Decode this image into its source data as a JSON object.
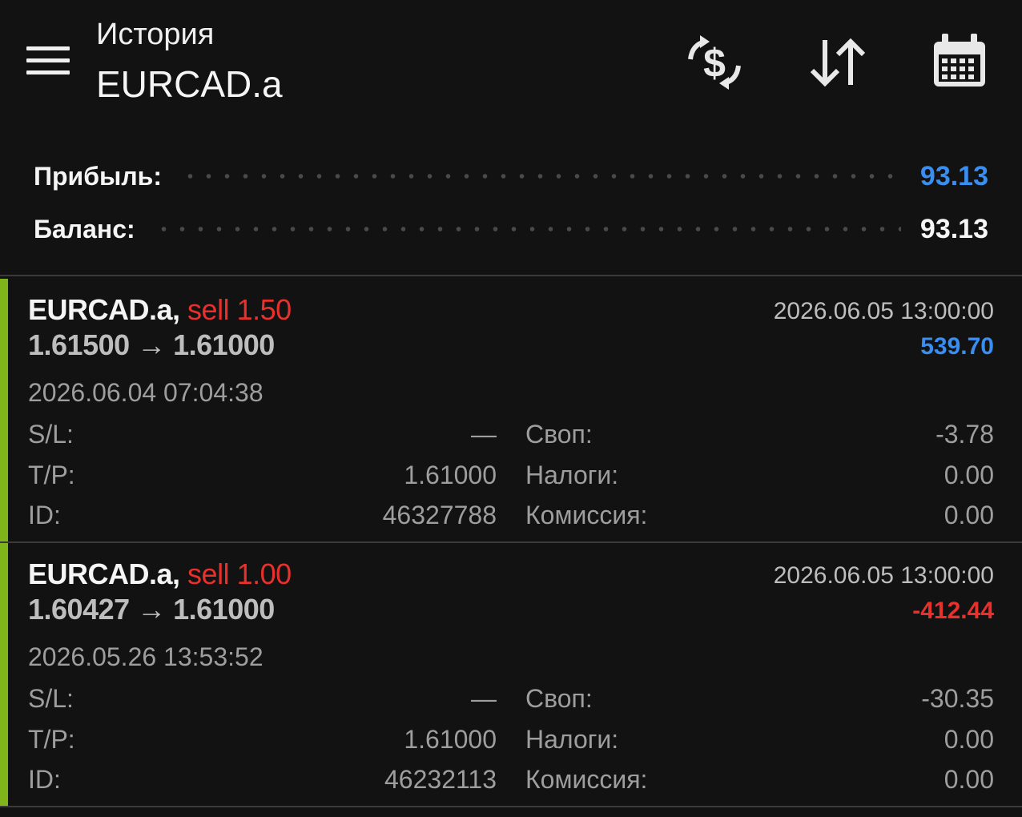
{
  "header": {
    "subtitle": "История",
    "title": "EURCAD.a",
    "icons": [
      "menu-icon",
      "currency-exchange-icon",
      "sort-icon",
      "calendar-icon"
    ]
  },
  "summary": {
    "profit_label": "Прибыль:",
    "profit_value": "93.13",
    "balance_label": "Баланс:",
    "balance_value": "93.13"
  },
  "deals": [
    {
      "symbol": "EURCAD.a,",
      "side": "sell 1.50",
      "prices": "1.61500 → 1.61000",
      "close_time": "2026.06.05 13:00:00",
      "profit": "539.70",
      "open_time": "2026.06.04 07:04:38",
      "sl_label": "S/L:",
      "sl_value": "—",
      "tp_label": "T/P:",
      "tp_value": "1.61000",
      "id_label": "ID:",
      "id_value": "46327788",
      "swap_label": "Своп:",
      "swap_value": "-3.78",
      "taxes_label": "Налоги:",
      "taxes_value": "0.00",
      "commission_label": "Комиссия:",
      "commission_value": "0.00"
    },
    {
      "symbol": "EURCAD.a,",
      "side": "sell 1.00",
      "prices": "1.60427 → 1.61000",
      "close_time": "2026.06.05 13:00:00",
      "profit": "-412.44",
      "open_time": "2026.05.26 13:53:52",
      "sl_label": "S/L:",
      "sl_value": "—",
      "tp_label": "T/P:",
      "tp_value": "1.61000",
      "id_label": "ID:",
      "id_value": "46232113",
      "swap_label": "Своп:",
      "swap_value": "-30.35",
      "taxes_label": "Налоги:",
      "taxes_value": "0.00",
      "commission_label": "Комиссия:",
      "commission_value": "0.00"
    }
  ],
  "colors": {
    "background": "#121212",
    "positive": "#3a8ef0",
    "negative": "#e8312c",
    "accent_bar": "#7fb51a"
  }
}
